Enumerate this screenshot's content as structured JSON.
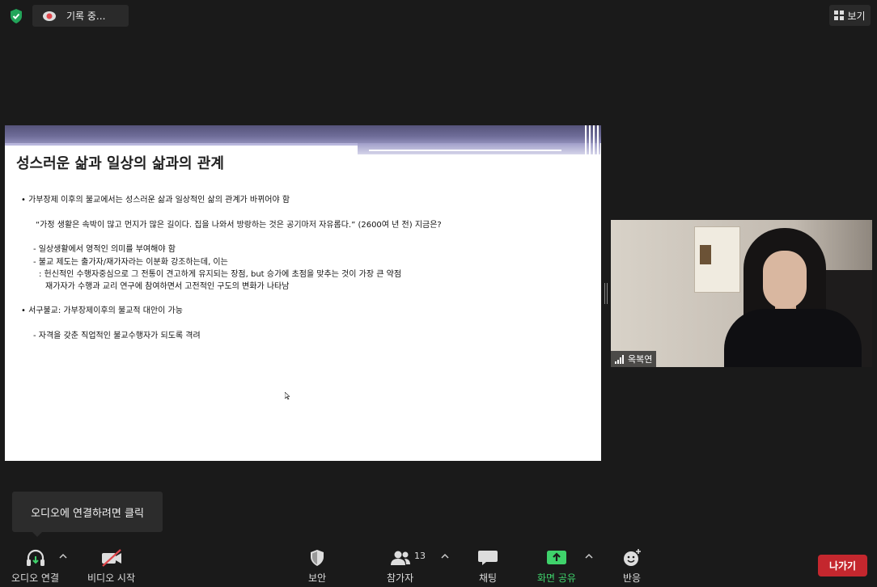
{
  "top_bar": {
    "recording_label": "기록 중...",
    "view_label": "보기"
  },
  "slide": {
    "title": "성스러운 삶과 일상의 삶과의 관계",
    "lines": [
      "•   가부장제 이후의 불교에서는 성스러운 삶과 일상적인 삶의 관계가 바뀌어야 함",
      "“가정 생활은 속박이 많고 먼지가 많은 길이다. 집을 나와서 방랑하는 것은 공기마저 자유롭다.” (2600여 년 전) 지금은?",
      "- 일상생활에서 영적인 의미를 부여해야 함",
      "- 불교 제도는 출가자/재가자라는 이분화 강조하는데, 이는",
      ": 헌신적인 수행자중심으로 그 전통이 견고하게 유지되는 장점, but 승가에 초점을 맞추는 것이 가장 큰 약점",
      "재가자가 수행과 교리 연구에 참여하면서 고전적인 구도의 변화가 나타남",
      "•   서구불교: 가부장제이후의 불교적 대안이 가능",
      "- 자격을 갖춘 직업적인 불교수행자가 되도록 격려"
    ]
  },
  "video": {
    "participant_name": "옥복연"
  },
  "tooltip": {
    "text": "오디오에 연결하려면 클릭"
  },
  "toolbar": {
    "audio_label": "오디오 연결",
    "video_label": "비디오 시작",
    "security_label": "보안",
    "participants_label": "참가자",
    "participants_count": "13",
    "chat_label": "채팅",
    "share_label": "화면 공유",
    "reactions_label": "반응",
    "leave_label": "나가기"
  },
  "colors": {
    "accent_green": "#3fd26b",
    "leave_red": "#c4272e",
    "video_off_red": "#e0474c",
    "background": "#1a1a1a"
  },
  "icons": [
    "shield-check-icon",
    "record-icon",
    "grid-view-icon",
    "headphones-icon",
    "video-off-icon",
    "security-shield-icon",
    "participants-icon",
    "chat-icon",
    "share-screen-icon",
    "reaction-icon",
    "signal-icon",
    "chevron-up-icon"
  ]
}
